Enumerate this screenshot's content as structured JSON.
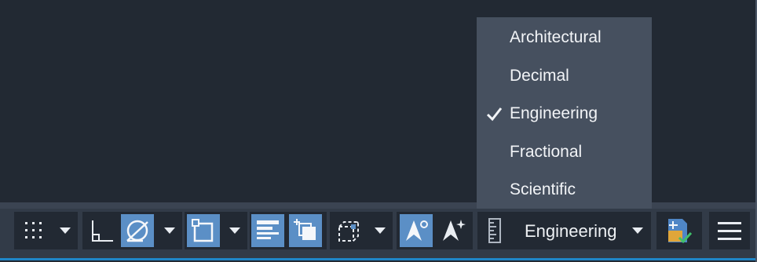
{
  "units_menu": {
    "items": [
      {
        "label": "Architectural",
        "checked": false
      },
      {
        "label": "Decimal",
        "checked": false
      },
      {
        "label": "Engineering",
        "checked": true
      },
      {
        "label": "Fractional",
        "checked": false
      },
      {
        "label": "Scientific",
        "checked": false
      }
    ]
  },
  "status_bar": {
    "units_value": "Engineering",
    "buttons": [
      {
        "icon": "grid-display-icon",
        "active": false
      },
      {
        "icon": "ortho-mode-icon",
        "active": false
      },
      {
        "icon": "polar-tracking-icon",
        "active": true
      },
      {
        "icon": "object-snap-icon",
        "active": true
      },
      {
        "icon": "lineweight-icon",
        "active": true
      },
      {
        "icon": "selection-cycling-icon",
        "active": true
      },
      {
        "icon": "3d-object-snap-icon",
        "active": false
      },
      {
        "icon": "annotation-visibility-icon",
        "active": true
      },
      {
        "icon": "auto-scale-icon",
        "active": false
      },
      {
        "icon": "units-icon",
        "active": false
      },
      {
        "icon": "quick-properties-icon",
        "active": false
      },
      {
        "icon": "customization-menu-icon",
        "active": false
      }
    ]
  },
  "colors": {
    "accent": "#5b8fc6",
    "background": "#222933",
    "menu": "#46505f"
  }
}
